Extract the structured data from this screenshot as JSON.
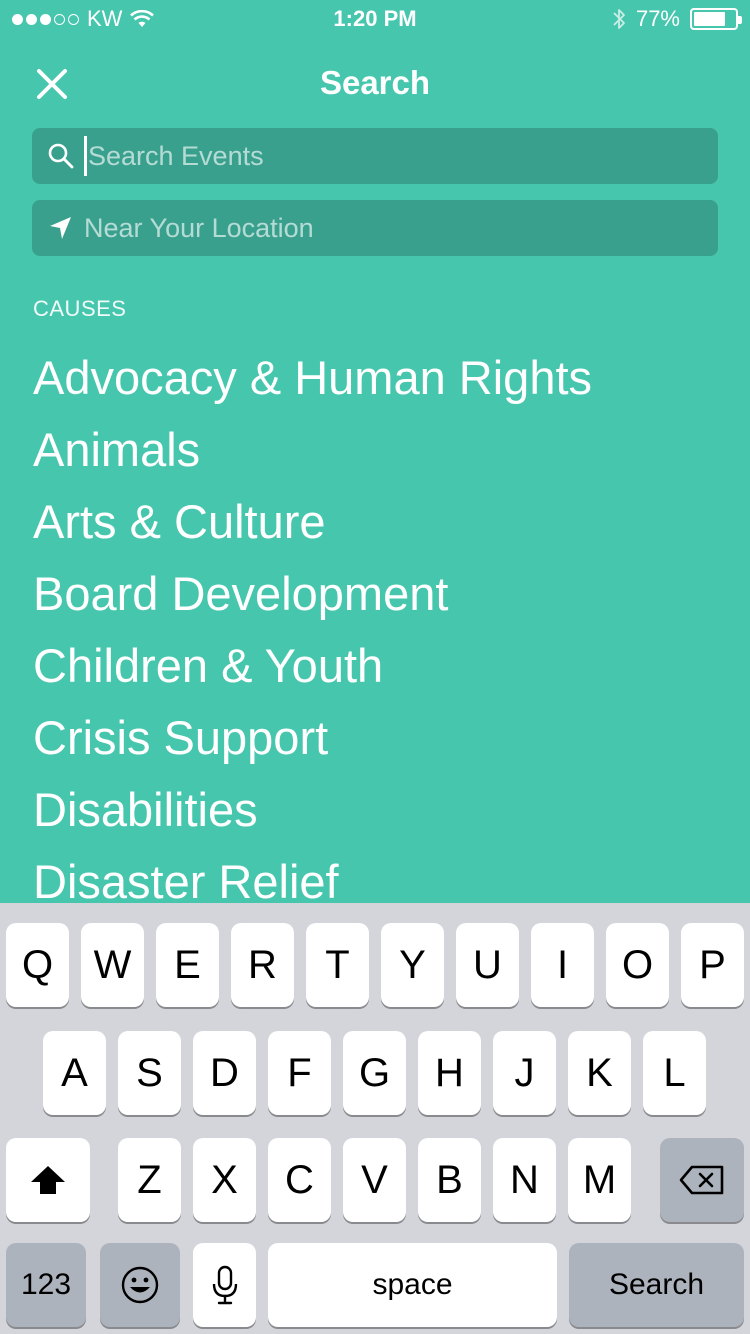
{
  "status_bar": {
    "carrier": "KW",
    "time": "1:20 PM",
    "battery": "77%",
    "battery_level": 0.77,
    "signal_bars": 3
  },
  "header": {
    "title": "Search"
  },
  "search": {
    "placeholder": "Search Events",
    "value": ""
  },
  "location": {
    "placeholder": "Near Your Location",
    "value": ""
  },
  "causes": {
    "label": "CAUSES",
    "items": [
      "Advocacy & Human Rights",
      "Animals",
      "Arts & Culture",
      "Board Development",
      "Children & Youth",
      "Crisis Support",
      "Disabilities",
      "Disaster Relief"
    ]
  },
  "keyboard": {
    "row1": [
      "Q",
      "W",
      "E",
      "R",
      "T",
      "Y",
      "U",
      "I",
      "O",
      "P"
    ],
    "row2": [
      "A",
      "S",
      "D",
      "F",
      "G",
      "H",
      "J",
      "K",
      "L"
    ],
    "row3": [
      "Z",
      "X",
      "C",
      "V",
      "B",
      "N",
      "M"
    ],
    "numbers_label": "123",
    "space_label": "space",
    "return_label": "Search"
  },
  "colors": {
    "background": "#47c6ae",
    "field": "#3aa08e",
    "keyboard": "#d3d5db"
  }
}
